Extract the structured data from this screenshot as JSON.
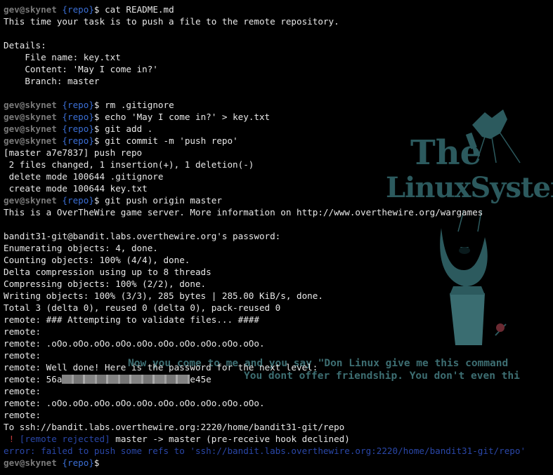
{
  "prompt": {
    "user": "gev@skynet",
    "repo": "{repo}",
    "sign": "$"
  },
  "wallpaper": {
    "title_line1": "The",
    "title_line2": "LinuxSystem",
    "quote_line1": "Now you come to me and you say \"Don Linux give me this command",
    "quote_line2": "You dont offer friendship. You don't even thi",
    "accent_color": "#2c5a5e"
  },
  "lines": [
    {
      "type": "prompt",
      "cmd": " cat README.md"
    },
    {
      "type": "out",
      "text": "This time your task is to push a file to the remote repository."
    },
    {
      "type": "out",
      "text": ""
    },
    {
      "type": "out",
      "text": "Details:"
    },
    {
      "type": "out",
      "text": "    File name: key.txt"
    },
    {
      "type": "out",
      "text": "    Content: 'May I come in?'"
    },
    {
      "type": "out",
      "text": "    Branch: master"
    },
    {
      "type": "out",
      "text": ""
    },
    {
      "type": "prompt",
      "cmd": " rm .gitignore"
    },
    {
      "type": "prompt",
      "cmd": " echo 'May I come in?' > key.txt"
    },
    {
      "type": "prompt",
      "cmd": " git add ."
    },
    {
      "type": "prompt",
      "cmd": " git commit -m 'push repo'"
    },
    {
      "type": "out",
      "text": "[master a7e7837] push repo"
    },
    {
      "type": "out",
      "text": " 2 files changed, 1 insertion(+), 1 deletion(-)"
    },
    {
      "type": "out",
      "text": " delete mode 100644 .gitignore"
    },
    {
      "type": "out",
      "text": " create mode 100644 key.txt"
    },
    {
      "type": "prompt",
      "cmd": " git push origin master"
    },
    {
      "type": "out",
      "text": "This is a OverTheWire game server. More information on http://www.overthewire.org/wargames"
    },
    {
      "type": "out",
      "text": ""
    },
    {
      "type": "out",
      "text": "bandit31-git@bandit.labs.overthewire.org's password:"
    },
    {
      "type": "out",
      "text": "Enumerating objects: 4, done."
    },
    {
      "type": "out",
      "text": "Counting objects: 100% (4/4), done."
    },
    {
      "type": "out",
      "text": "Delta compression using up to 8 threads"
    },
    {
      "type": "out",
      "text": "Compressing objects: 100% (2/2), done."
    },
    {
      "type": "out",
      "text": "Writing objects: 100% (3/3), 285 bytes | 285.00 KiB/s, done."
    },
    {
      "type": "out",
      "text": "Total 3 (delta 0), reused 0 (delta 0), pack-reused 0"
    },
    {
      "type": "out",
      "text": "remote: ### Attempting to validate files... ####"
    },
    {
      "type": "out",
      "text": "remote:"
    },
    {
      "type": "out",
      "text": "remote: .oOo.oOo.oOo.oOo.oOo.oOo.oOo.oOo.oOo.oOo."
    },
    {
      "type": "out",
      "text": "remote:"
    },
    {
      "type": "out",
      "text": "remote: Well done! Here is the password for the next level:"
    },
    {
      "type": "redacted",
      "before": "remote: 56a",
      "after": "e45e"
    },
    {
      "type": "out",
      "text": "remote:"
    },
    {
      "type": "out",
      "text": "remote: .oOo.oOo.oOo.oOo.oOo.oOo.oOo.oOo.oOo.oOo."
    },
    {
      "type": "out",
      "text": "remote:"
    },
    {
      "type": "out",
      "text": "To ssh://bandit.labs.overthewire.org:2220/home/bandit31-git/repo"
    },
    {
      "type": "rejected",
      "bang": " ! ",
      "tag": "[remote rejected]",
      "rest": " master -> master (pre-receive hook declined)"
    },
    {
      "type": "error",
      "text": "error: failed to push some refs to 'ssh://bandit.labs.overthewire.org:2220/home/bandit31-git/repo'"
    },
    {
      "type": "prompt",
      "cmd": ""
    }
  ]
}
